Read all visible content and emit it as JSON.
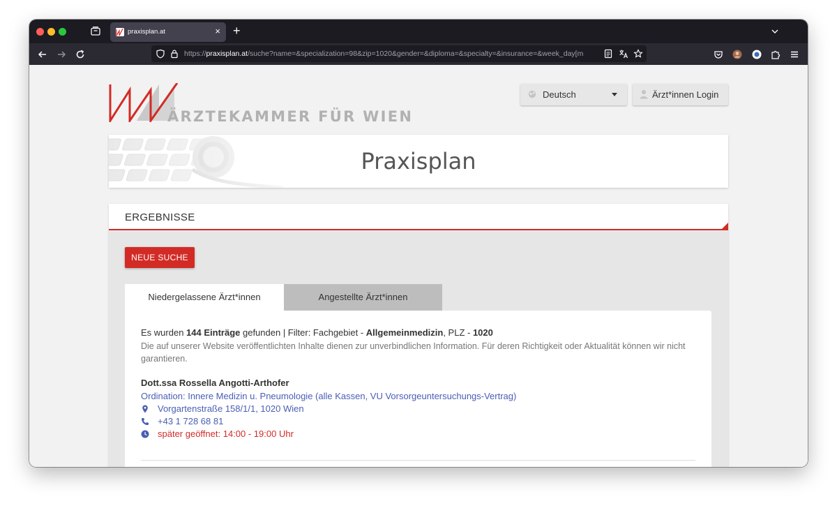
{
  "browser": {
    "tab_title": "praxisplan.at",
    "tab_close": "×",
    "new_tab": "+",
    "url_prefix": "https://",
    "url_host": "praxisplan.at",
    "url_rest": "/suche?name=&specialization=98&zip=1020&gender=&diploma=&specialty=&insurance=&week_day[m",
    "colors": {
      "tabbar": "#1c1b22",
      "navbar": "#2b2a33",
      "urlbar": "#1c1b22"
    }
  },
  "header": {
    "logo_text": "ÄRZTEKAMMER FÜR WIEN",
    "language": "Deutsch",
    "login": "Ärzt*innen Login",
    "banner_title": "Praxisplan"
  },
  "results": {
    "title": "ERGEBNISSE",
    "new_search": "NEUE SUCHE",
    "tabs": [
      {
        "label": "Niedergelassene Ärzt*innen",
        "active": true
      },
      {
        "label": "Angestellte Ärzt*innen",
        "active": false
      }
    ],
    "summary": {
      "prefix": "Es wurden ",
      "count": "144 Einträge",
      "middle": " gefunden | Filter: Fachgebiet - ",
      "specialty": "Allgemeinmedizin",
      "plz_label": ", PLZ - ",
      "plz": "1020"
    },
    "disclaimer": "Die auf unserer Website veröffentlichten Inhalte dienen zur unverbindlichen Information. Für deren Richtigkeit oder Aktualität können wir nicht garantieren.",
    "entries": [
      {
        "name": "Dott.ssa Rossella Angotti-Arthofer",
        "ordination": "Ordination: Innere Medizin u. Pneumologie (alle Kassen, VU Vorsorgeuntersuchungs-Vertrag)",
        "address": "Vorgartenstraße 158/1/1, 1020 Wien",
        "phone": "+43 1 728 68 81",
        "hours": "später geöffnet: 14:00 - 19:00 Uhr"
      }
    ]
  },
  "colors": {
    "accent": "#d22b26",
    "link": "#4a5eb4",
    "logo_gray": "#b1b1b1"
  }
}
